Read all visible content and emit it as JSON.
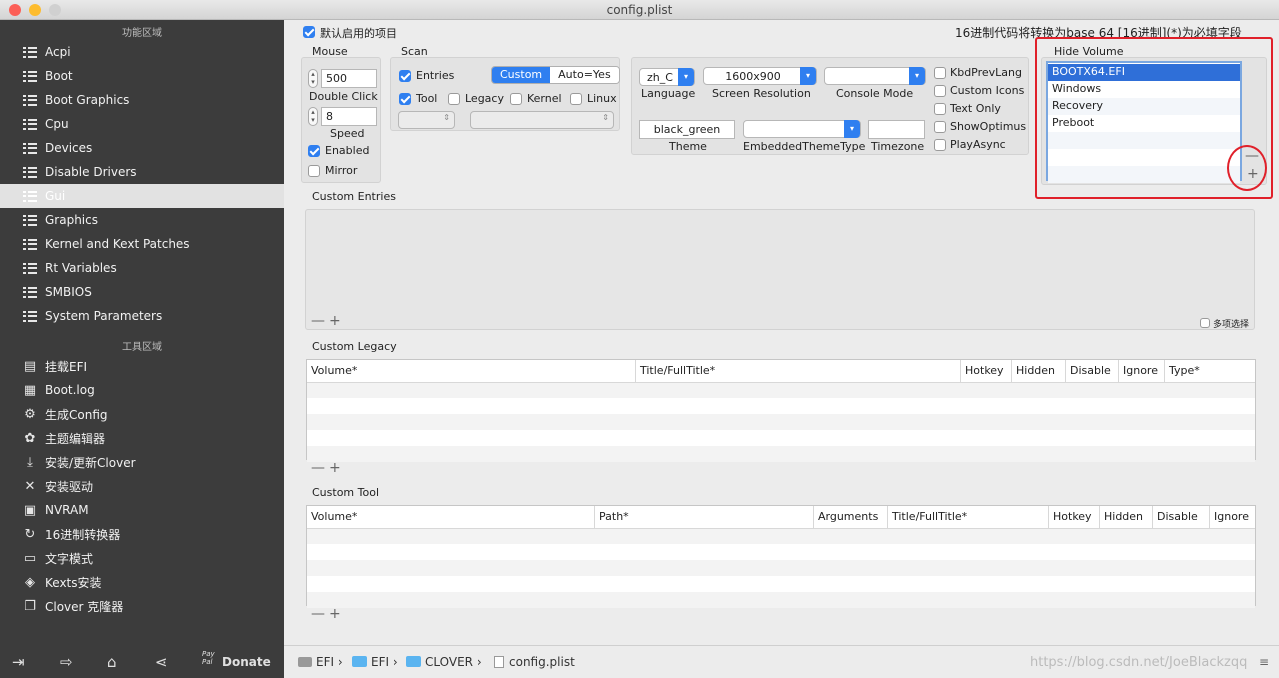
{
  "window": {
    "title": "config.plist"
  },
  "sidebar": {
    "section_functions": "功能区域",
    "section_tools": "工具区域",
    "items": [
      {
        "label": "Acpi"
      },
      {
        "label": "Boot"
      },
      {
        "label": "Boot Graphics"
      },
      {
        "label": "Cpu"
      },
      {
        "label": "Devices"
      },
      {
        "label": "Disable Drivers"
      },
      {
        "label": "Gui"
      },
      {
        "label": "Graphics"
      },
      {
        "label": "Kernel and Kext Patches"
      },
      {
        "label": "Rt Variables"
      },
      {
        "label": "SMBIOS"
      },
      {
        "label": "System Parameters"
      }
    ],
    "selected": "Gui",
    "tools": [
      {
        "label": "挂载EFI"
      },
      {
        "label": "Boot.log"
      },
      {
        "label": "生成Config"
      },
      {
        "label": "主题编辑器"
      },
      {
        "label": "安装/更新Clover"
      },
      {
        "label": "安装驱动"
      },
      {
        "label": "NVRAM"
      },
      {
        "label": "16进制转换器"
      },
      {
        "label": "文字模式"
      },
      {
        "label": "Kexts安装"
      },
      {
        "label": "Clover 克隆器"
      }
    ],
    "donate_label": "Donate",
    "paypal_label": "Pay Pal"
  },
  "header": {
    "default_items_label": "默认启用的项目",
    "hint": "16进制代码将转换为base 64 [16进制](*)为必填字段"
  },
  "mouse": {
    "title": "Mouse",
    "double_click_value": "500",
    "double_click_label": "Double Click",
    "speed_value": "8",
    "speed_label": "Speed",
    "enabled_label": "Enabled",
    "mirror_label": "Mirror"
  },
  "scan": {
    "title": "Scan",
    "entries_label": "Entries",
    "segment": [
      "Custom",
      "Auto=Yes"
    ],
    "tool_label": "Tool",
    "legacy_label": "Legacy",
    "kernel_label": "Kernel",
    "linux_label": "Linux"
  },
  "settings": {
    "language_value": "zh_C",
    "language_label": "Language",
    "resolution_value": "1600x900",
    "resolution_label": "Screen Resolution",
    "console_value": "",
    "console_label": "Console Mode",
    "theme_value": "black_green",
    "theme_label": "Theme",
    "embedded_value": "",
    "embedded_label": "EmbeddedThemeType",
    "timezone_value": "",
    "timezone_label": "Timezone",
    "checks": [
      "KbdPrevLang",
      "Custom Icons",
      "Text Only",
      "ShowOptimus",
      "PlayAsync"
    ]
  },
  "hide_volume": {
    "title": "Hide Volume",
    "items": [
      "BOOTX64.EFI",
      "Windows",
      "Recovery",
      "Preboot"
    ],
    "selected": "BOOTX64.EFI"
  },
  "custom_entries": {
    "title": "Custom Entries",
    "multi_select": "多项选择"
  },
  "custom_legacy": {
    "title": "Custom Legacy",
    "columns": [
      "Volume*",
      "Title/FullTitle*",
      "Hotkey",
      "Hidden",
      "Disable",
      "Ignore",
      "Type*"
    ]
  },
  "custom_tool": {
    "title": "Custom Tool",
    "columns": [
      "Volume*",
      "Path*",
      "Arguments",
      "Title/FullTitle*",
      "Hotkey",
      "Hidden",
      "Disable",
      "Ignore"
    ]
  },
  "path": [
    "EFI",
    "EFI",
    "CLOVER",
    "config.plist"
  ],
  "watermark": "https://blog.csdn.net/JoeBlackzqq",
  "colors": {
    "accent": "#2f7ff0",
    "sidebar": "#3c3c3c",
    "annotation": "#e0202a"
  }
}
